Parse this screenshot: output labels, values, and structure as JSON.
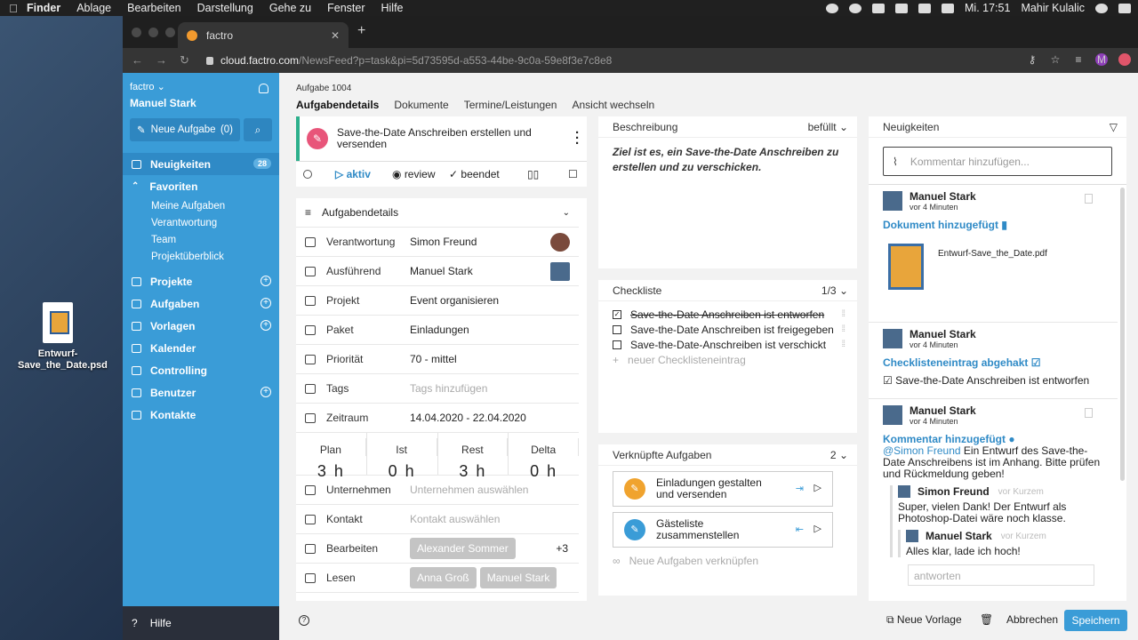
{
  "menubar": {
    "app": "Finder",
    "items": [
      "Ablage",
      "Bearbeiten",
      "Darstellung",
      "Gehe zu",
      "Fenster",
      "Hilfe"
    ],
    "clock": "Mi. 17:51",
    "user": "Mahir Kulalic"
  },
  "desktop": {
    "file_name": "Entwurf-Save_the_Date.psd"
  },
  "browser": {
    "tab_title": "factro",
    "url_host": "cloud.factro.com",
    "url_path": "/NewsFeed?p=task&pi=5d73595d-a553-44be-9c0a-59e8f3e7c8e8",
    "profile_initial": "M"
  },
  "sidebar": {
    "org": "factro",
    "user": "Manuel Stark",
    "new_task": "Neue Aufgabe",
    "new_task_count": "(0)",
    "items": [
      {
        "label": "Neuigkeiten",
        "badge": "28"
      },
      {
        "label": "Favoriten"
      },
      {
        "label": "Projekte"
      },
      {
        "label": "Aufgaben"
      },
      {
        "label": "Vorlagen"
      },
      {
        "label": "Kalender"
      },
      {
        "label": "Controlling"
      },
      {
        "label": "Benutzer"
      },
      {
        "label": "Kontakte"
      }
    ],
    "favorites": [
      "Meine Aufgaben",
      "Verantwortung",
      "Team",
      "Projektüberblick"
    ],
    "help": "Hilfe"
  },
  "task": {
    "breadcrumb": "Aufgabe 1004",
    "tabs": [
      "Aufgabendetails",
      "Dokumente",
      "Termine/Leistungen",
      "Ansicht wechseln"
    ],
    "title": "Save-the-Date Anschreiben erstellen und versenden",
    "status": {
      "active": "aktiv",
      "review": "review",
      "done": "beendet"
    },
    "details_header": "Aufgabendetails",
    "fields": {
      "verantwortung_label": "Verantwortung",
      "verantwortung": "Simon Freund",
      "ausfuehrend_label": "Ausführend",
      "ausfuehrend": "Manuel Stark",
      "projekt_label": "Projekt",
      "projekt": "Event organisieren",
      "paket_label": "Paket",
      "paket": "Einladungen",
      "prioritaet_label": "Priorität",
      "prioritaet": "70 - mittel",
      "tags_label": "Tags",
      "tags_placeholder": "Tags hinzufügen",
      "zeitraum_label": "Zeitraum",
      "zeitraum": "14.04.2020 - 22.04.2020",
      "unternehmen_label": "Unternehmen",
      "unternehmen_placeholder": "Unternehmen auswählen",
      "kontakt_label": "Kontakt",
      "kontakt_placeholder": "Kontakt auswählen",
      "bearbeiten_label": "Bearbeiten",
      "bearbeiten_chip": "Alexander Sommer",
      "bearbeiten_more": "+3",
      "lesen_label": "Lesen",
      "lesen_chips": [
        "Anna Groß",
        "Manuel Stark"
      ]
    },
    "stats": [
      {
        "label": "Plan",
        "value": "3 h"
      },
      {
        "label": "Ist",
        "value": "0 h"
      },
      {
        "label": "Rest",
        "value": "3 h"
      },
      {
        "label": "Delta",
        "value": "0 h"
      }
    ]
  },
  "description": {
    "header": "Beschreibung",
    "state": "befüllt",
    "text": "Ziel ist es, ein Save-the-Date Anschreiben zu erstellen und zu verschicken."
  },
  "checklist": {
    "header": "Checkliste",
    "count": "1/3",
    "items": [
      {
        "label": "Save-the-Date Anschreiben ist entworfen",
        "done": true
      },
      {
        "label": "Save-the-Date Anschreiben ist freigegeben",
        "done": false
      },
      {
        "label": "Save-the-Date-Anschreiben ist verschickt",
        "done": false
      }
    ],
    "add": "neuer Checklisteneintrag"
  },
  "linked": {
    "header": "Verknüpfte Aufgaben",
    "count": "2",
    "items": [
      {
        "label": "Einladungen gestalten und versenden",
        "color": "#f0a32e"
      },
      {
        "label": "Gästeliste zusammenstellen",
        "color": "#3a9cd7"
      }
    ],
    "add": "Neue Aufgaben verknüpfen"
  },
  "news": {
    "header": "Neuigkeiten",
    "comment_placeholder": "Kommentar hinzufügen...",
    "entries": [
      {
        "user": "Manuel Stark",
        "time": "vor 4 Minuten",
        "action": "Dokument hinzugefügt",
        "file": "Entwurf-Save_the_Date.pdf"
      },
      {
        "user": "Manuel Stark",
        "time": "vor 4 Minuten",
        "action": "Checklisteneintrag abgehakt",
        "detail": "Save-the-Date Anschreiben ist entworfen"
      },
      {
        "user": "Manuel Stark",
        "time": "vor 4 Minuten",
        "action": "Kommentar hinzugefügt",
        "mention": "@Simon Freund",
        "text": " Ein Entwurf des Save-the-Date Anschreibens ist im Anhang. Bitte prüfen und Rückmeldung geben!"
      }
    ],
    "replies": [
      {
        "user": "Simon Freund",
        "time": "vor Kurzem",
        "text": "Super, vielen Dank! Der Entwurf als Photoshop-Datei wäre noch klasse."
      },
      {
        "user": "Manuel Stark",
        "time": "vor Kurzem",
        "text": "Alles klar, lade ich hoch!"
      }
    ],
    "answer_placeholder": "antworten"
  },
  "footer": {
    "new_template": "Neue Vorlage",
    "cancel": "Abbrechen",
    "save": "Speichern"
  }
}
